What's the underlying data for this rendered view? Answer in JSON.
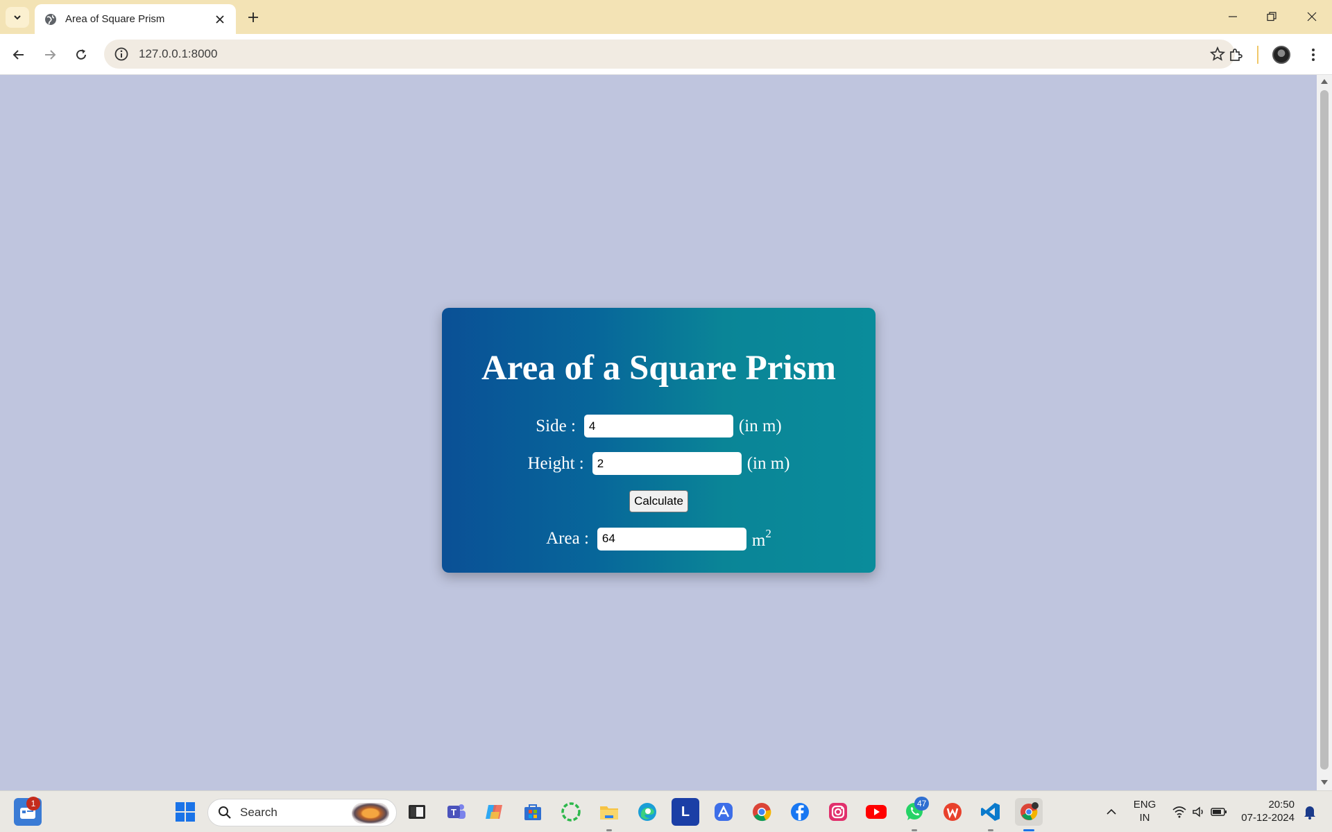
{
  "browser": {
    "tab_title": "Area of Square Prism",
    "url": "127.0.0.1:8000"
  },
  "page": {
    "heading": "Area of a Square Prism",
    "side_label": "Side :",
    "side_value": "4",
    "side_unit": "(in m)",
    "height_label": "Height :",
    "height_value": "2",
    "height_unit": "(in m)",
    "calculate_label": "Calculate",
    "area_label": "Area :",
    "area_value": "64",
    "area_unit": "m",
    "area_unit_exp": "2"
  },
  "taskbar": {
    "search_label": "Search",
    "widgets_badge": "1",
    "whatsapp_badge": "47",
    "lang_line1": "ENG",
    "lang_line2": "IN",
    "time": "20:50",
    "date": "07-12-2024",
    "apps": [
      "widgets-icon",
      "windows-start-icon",
      "search-icon",
      "terminal-icon",
      "teams-icon",
      "copilot-icon",
      "store-icon",
      "clock-app-icon",
      "file-explorer-icon",
      "edge-icon",
      "l-app-icon",
      "arc-icon",
      "chrome-icon",
      "facebook-icon",
      "instagram-icon",
      "youtube-icon",
      "whatsapp-icon",
      "wps-office-icon",
      "vscode-icon",
      "chrome-profile-icon"
    ]
  },
  "colors": {
    "page_bg": "#bfc5de",
    "card_gradient_start": "#0a5096",
    "card_gradient_end": "#0a8c9b",
    "tabstrip": "#f3e3b5"
  }
}
